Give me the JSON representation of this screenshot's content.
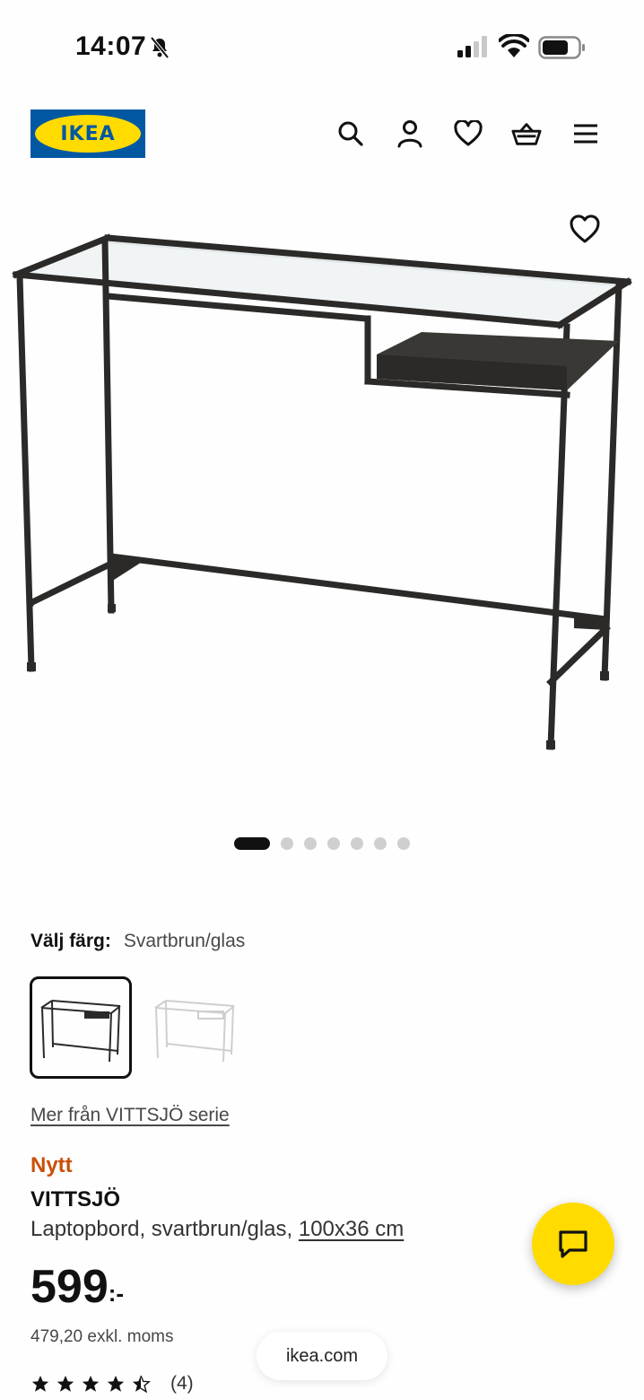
{
  "status_bar": {
    "time": "14:07"
  },
  "header": {
    "logo_text": "IKEA",
    "brand_blue": "#0058a3",
    "brand_yellow": "#ffdb00"
  },
  "carousel": {
    "total": 7,
    "active_index": 0
  },
  "color_select": {
    "label": "Välj färg:",
    "value": "Svartbrun/glas",
    "options": [
      "Svartbrun/glas",
      "Vit/glas"
    ],
    "selected_index": 0
  },
  "series_link": "Mer från VITTSJÖ serie",
  "product": {
    "badge": "Nytt",
    "badge_color": "#ca5008",
    "name": "VITTSJÖ",
    "description": "Laptopbord, svartbrun/glas, ",
    "size": "100x36 cm",
    "price": "599",
    "price_suffix": ":-",
    "ex_vat": "479,20 exkl. moms",
    "rating_value": 4.5,
    "rating_count": "(4)"
  },
  "browser": {
    "url": "ikea.com"
  }
}
